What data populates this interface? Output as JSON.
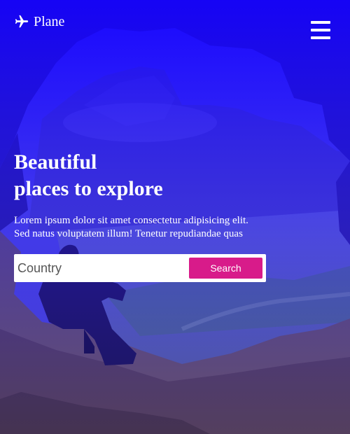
{
  "nav": {
    "brand": "Plane",
    "logo_icon": "airplane-icon",
    "menu_icon": "hamburger-menu-icon"
  },
  "hero": {
    "headline_line1": "Beautiful",
    "headline_line2": "places to explore",
    "subtitle_line1": "Lorem ipsum dolor sit amet consectetur adipisicing elit.",
    "subtitle_line2": "Sed natus voluptatem illum! Tenetur repudiandae quas",
    "background_image": "person sitting at cave opening overlooking mountains and valley",
    "overlay_color": "#1f12ff"
  },
  "search": {
    "placeholder": "Country",
    "value": "",
    "button_label": "Search",
    "button_color": "#d81b8a"
  }
}
